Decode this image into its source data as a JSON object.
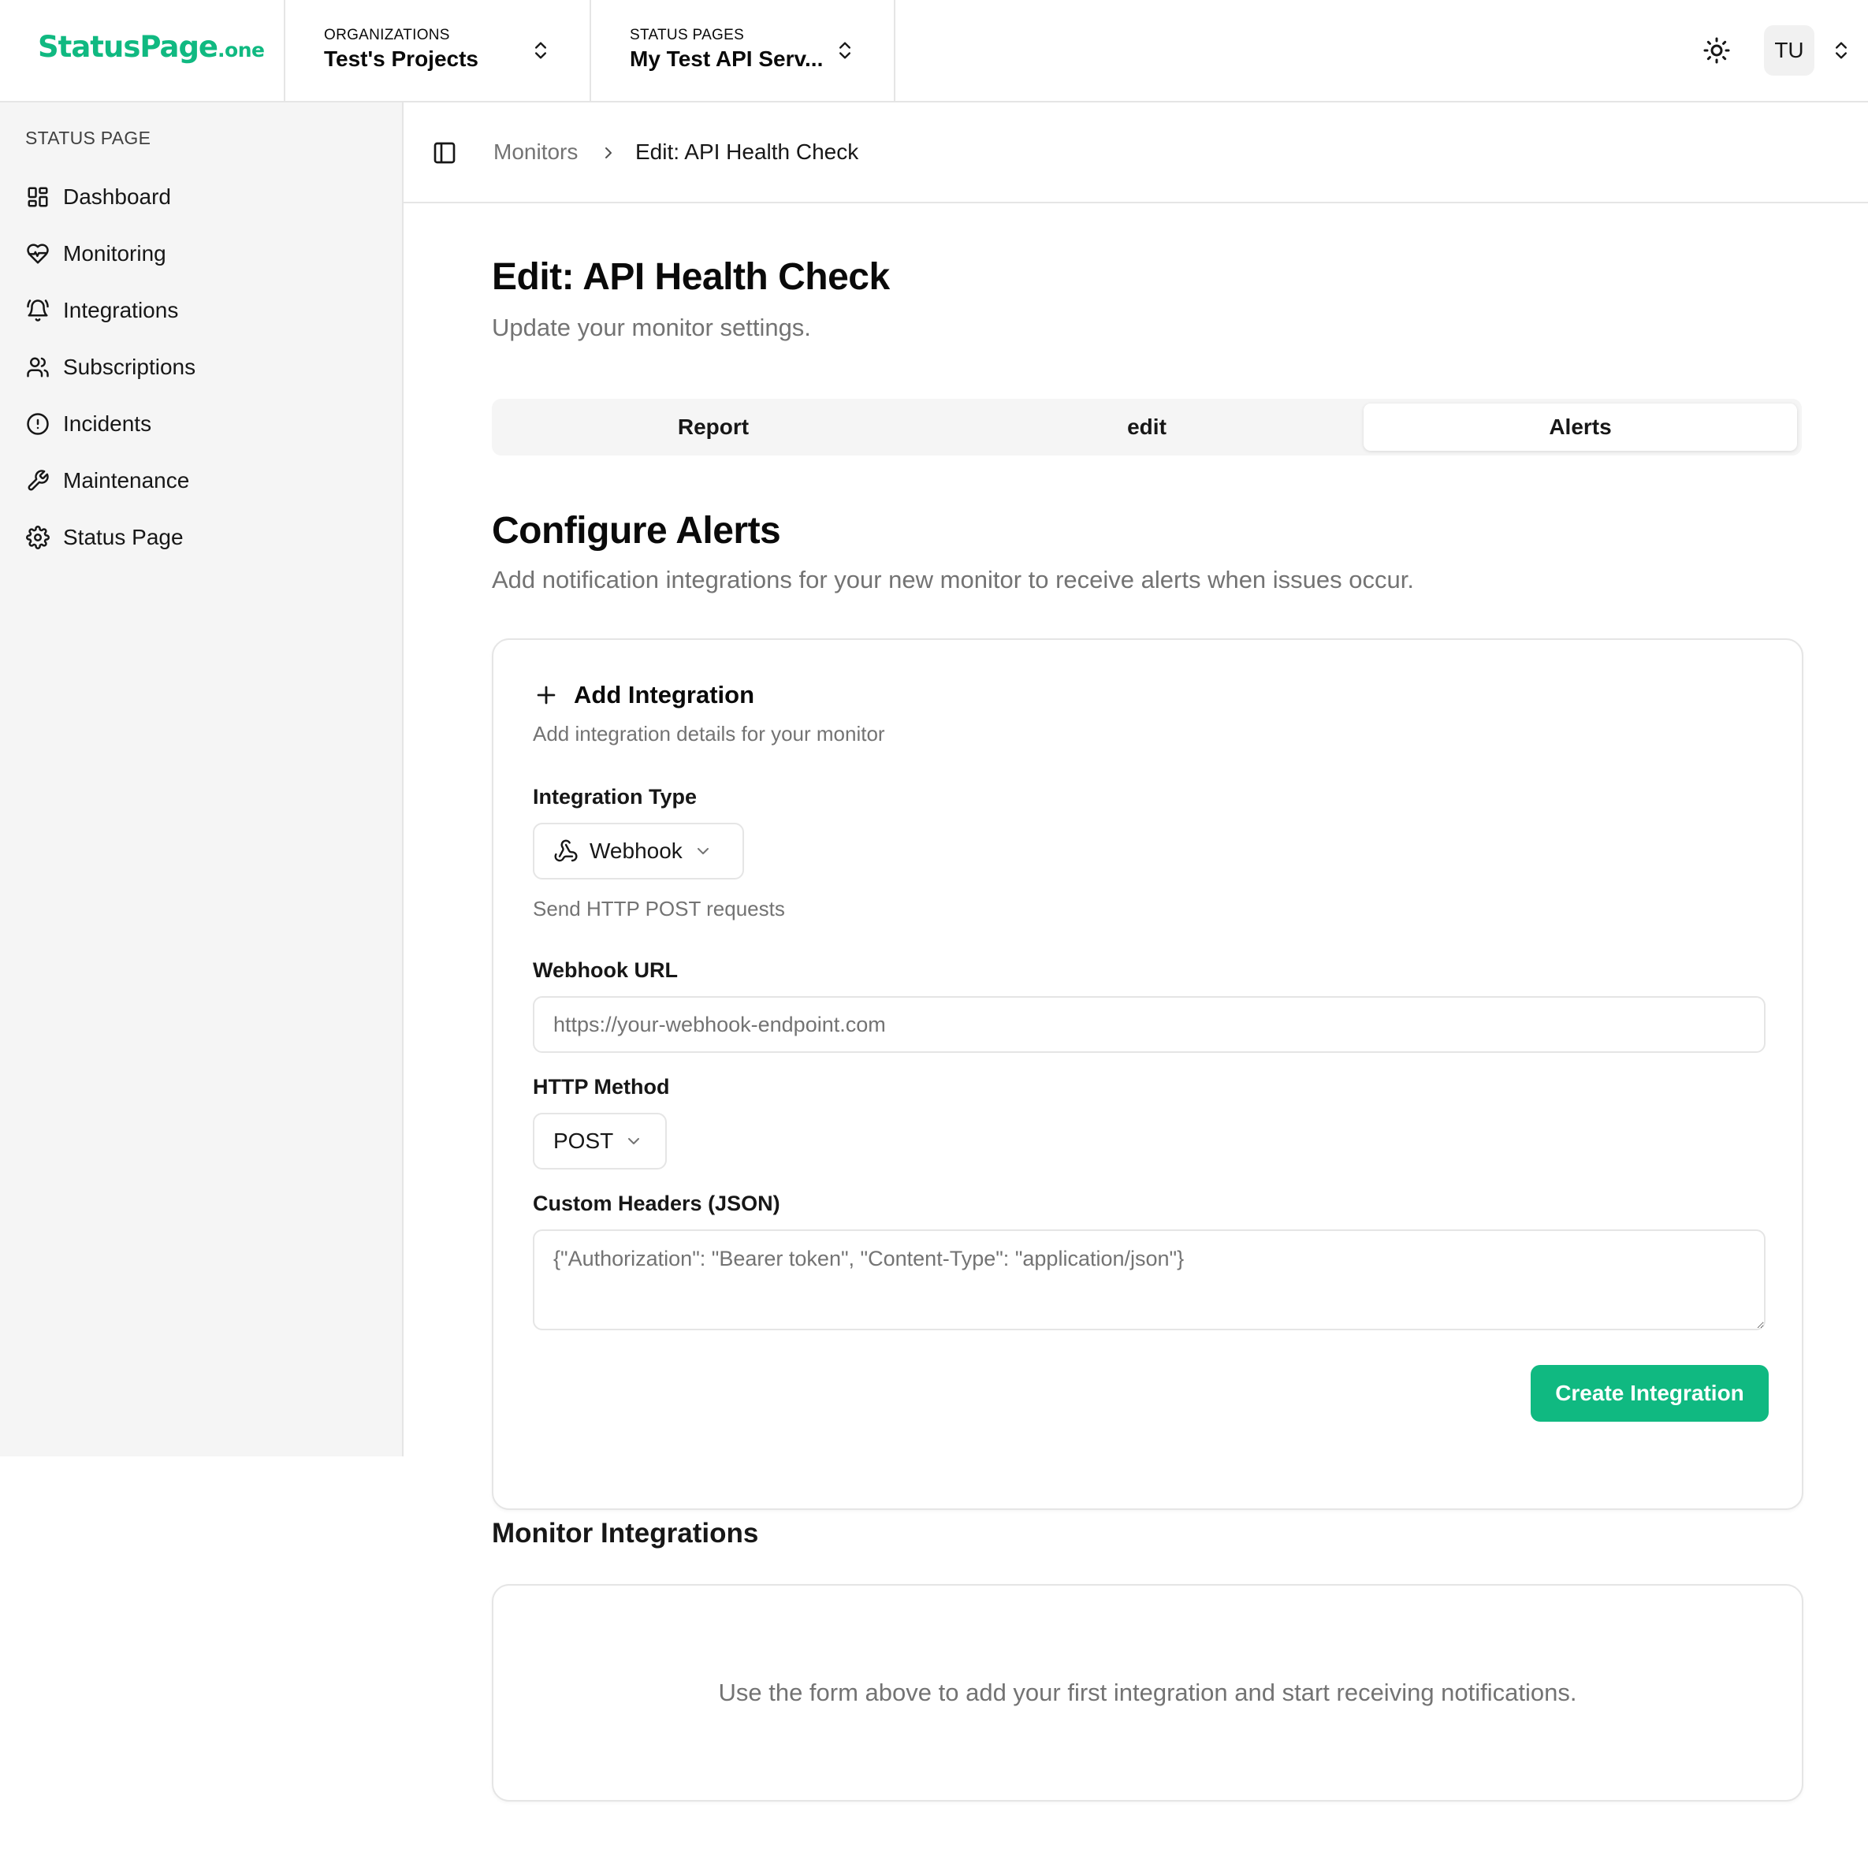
{
  "brand": {
    "name": "StatusPage",
    "suffix": ".one",
    "color": "#10b981"
  },
  "header": {
    "organizations": {
      "caption": "ORGANIZATIONS",
      "value": "Test's Projects"
    },
    "status_pages": {
      "caption": "STATUS PAGES",
      "value": "My Test API Serv..."
    },
    "theme_icon": "sun-icon",
    "user_initials": "TU"
  },
  "sidebar": {
    "section_caption": "STATUS PAGE",
    "items": [
      {
        "label": "Dashboard",
        "icon": "dashboard-icon"
      },
      {
        "label": "Monitoring",
        "icon": "heart-pulse-icon"
      },
      {
        "label": "Integrations",
        "icon": "bell-ring-icon"
      },
      {
        "label": "Subscriptions",
        "icon": "users-icon"
      },
      {
        "label": "Incidents",
        "icon": "alert-circle-icon"
      },
      {
        "label": "Maintenance",
        "icon": "wrench-icon"
      },
      {
        "label": "Status Page",
        "icon": "gear-icon"
      }
    ]
  },
  "breadcrumb": {
    "parent": "Monitors",
    "current": "Edit: API Health Check"
  },
  "page": {
    "title": "Edit: API Health Check",
    "subtitle": "Update your monitor settings.",
    "tabs": [
      {
        "label": "Report",
        "active": false
      },
      {
        "label": "edit",
        "active": false
      },
      {
        "label": "Alerts",
        "active": true
      }
    ]
  },
  "alerts": {
    "title": "Configure Alerts",
    "subtitle": "Add notification integrations for your new monitor to receive alerts when issues occur.",
    "form": {
      "title": "Add Integration",
      "subtitle": "Add integration details for your monitor",
      "integration_type_label": "Integration Type",
      "integration_type_value": "Webhook",
      "integration_type_help": "Send HTTP POST requests",
      "webhook_url_label": "Webhook URL",
      "webhook_url_value": "",
      "webhook_url_placeholder": "https://your-webhook-endpoint.com",
      "http_method_label": "HTTP Method",
      "http_method_value": "POST",
      "headers_label": "Custom Headers (JSON)",
      "headers_value": "",
      "headers_placeholder": "{\"Authorization\": \"Bearer token\", \"Content-Type\": \"application/json\"}",
      "submit_label": "Create Integration"
    },
    "monitor_integrations": {
      "title": "Monitor Integrations",
      "empty_text": "Use the form above to add your first integration and start receiving notifications."
    }
  }
}
